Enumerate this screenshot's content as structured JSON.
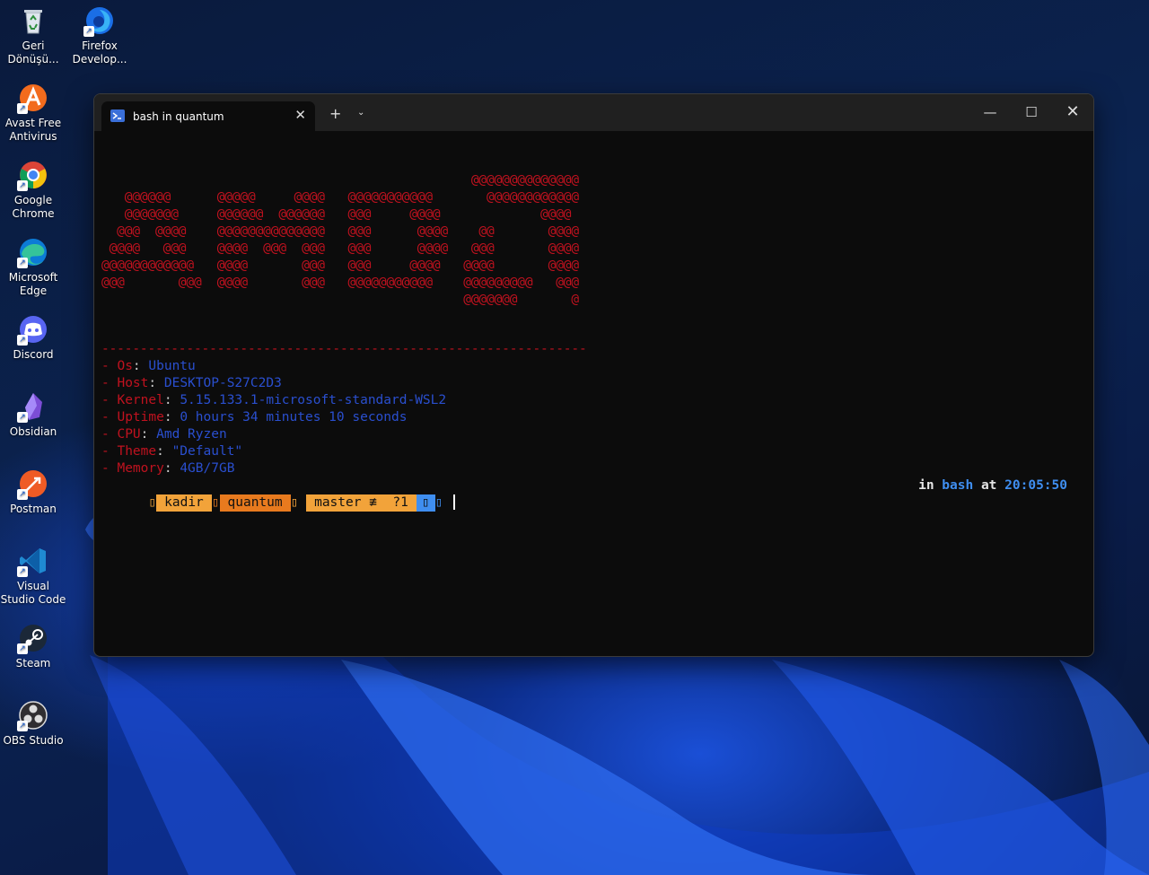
{
  "desktop": {
    "icons": [
      {
        "label": "Geri Dönüşü...",
        "icon": "recycle-bin-icon"
      },
      {
        "label": "Firefox Develop...",
        "icon": "firefox-developer-icon"
      },
      {
        "label": "Avast Free Antivirus",
        "icon": "avast-icon"
      },
      {
        "label": "Google Chrome",
        "icon": "chrome-icon"
      },
      {
        "label": "Microsoft Edge",
        "icon": "edge-icon"
      },
      {
        "label": "Discord",
        "icon": "discord-icon"
      },
      {
        "label": "Obsidian",
        "icon": "obsidian-icon"
      },
      {
        "label": "Postman",
        "icon": "postman-icon"
      },
      {
        "label": "Visual Studio Code",
        "icon": "vscode-icon"
      },
      {
        "label": "Steam",
        "icon": "steam-icon"
      },
      {
        "label": "OBS Studio",
        "icon": "obs-icon"
      }
    ]
  },
  "terminal": {
    "tab_title": "bash in quantum",
    "tab_close": "✕",
    "new_tab": "+",
    "dropdown": "⌄",
    "minimize": "—",
    "maximize": "☐",
    "close": "✕",
    "ascii_art": "                                                @@@@@@@@@@@@@@\n   @@@@@@      @@@@@     @@@@   @@@@@@@@@@@       @@@@@@@@@@@@\n   @@@@@@@     @@@@@@  @@@@@@   @@@     @@@@             @@@@\n  @@@  @@@@    @@@@@@@@@@@@@@   @@@      @@@@    @@       @@@@\n @@@@   @@@    @@@@  @@@  @@@   @@@      @@@@   @@@       @@@@\n@@@@@@@@@@@@   @@@@       @@@   @@@     @@@@   @@@@       @@@@\n@@@       @@@  @@@@       @@@   @@@@@@@@@@@    @@@@@@@@@   @@@\n                                               @@@@@@@       @",
    "separator": "---------------------------------------------------------------",
    "info": [
      {
        "key": "- Os",
        "value": "Ubuntu"
      },
      {
        "key": "- Host",
        "value": "DESKTOP-S27C2D3"
      },
      {
        "key": "- Kernel",
        "value": "5.15.133.1-microsoft-standard-WSL2"
      },
      {
        "key": "- Uptime",
        "value": "0 hours 34 minutes 10 seconds"
      },
      {
        "key": "- CPU",
        "value": "Amd Ryzen"
      },
      {
        "key": "- Theme",
        "value": "\"Default\""
      },
      {
        "key": "- Memory",
        "value": "4GB/7GB"
      }
    ],
    "prompt": {
      "user": "kadir",
      "dir": "quantum",
      "git": "master ≢  ?1",
      "lead_glyph": "▯",
      "dir_glyph": "▯",
      "git_glyph": "▯ ",
      "blue_glyph": "▯",
      "trail_glyph": "▯",
      "right_in": "in",
      "right_shell": "bash",
      "right_at": "at",
      "right_time": "20:05:50"
    }
  }
}
